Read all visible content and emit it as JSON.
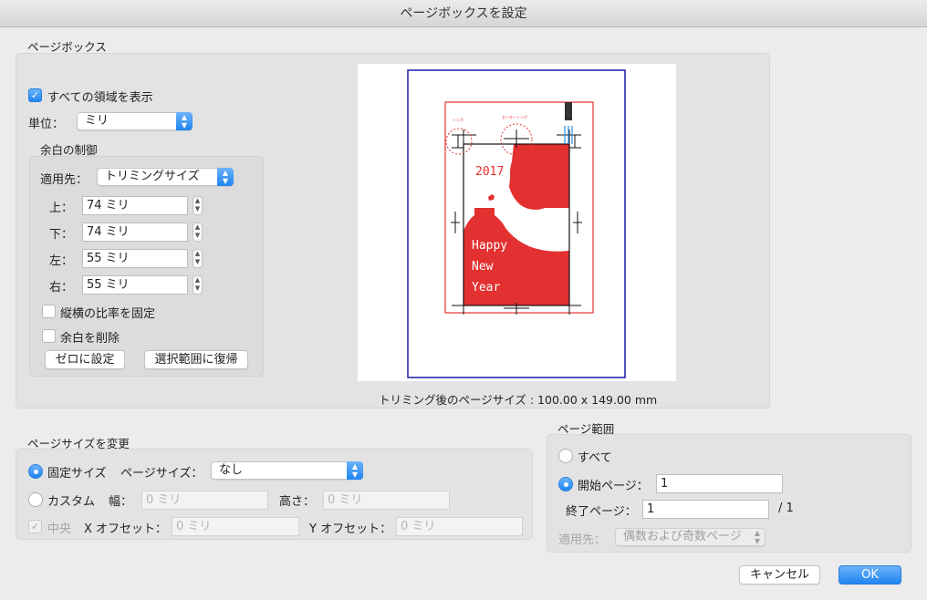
{
  "window": {
    "title": "ページボックスを設定"
  },
  "page_box": {
    "section_label": "ページボックス",
    "show_all": {
      "label": "すべての領域を表示",
      "checked": true
    },
    "unit": {
      "label": "単位：",
      "value": "ミリ"
    },
    "margins": {
      "section_label": "余白の制御",
      "apply_to": {
        "label": "適用先：",
        "value": "トリミングサイズ"
      },
      "top": {
        "label": "上：",
        "value": "74 ミリ"
      },
      "bottom": {
        "label": "下：",
        "value": "74 ミリ"
      },
      "left": {
        "label": "左：",
        "value": "55 ミリ"
      },
      "right": {
        "label": "右：",
        "value": "55 ミリ"
      },
      "constrain": {
        "label": "縦横の比率を固定",
        "checked": false
      },
      "remove_white": {
        "label": "余白を削除",
        "checked": false
      },
      "set_zero_label": "ゼロに設定",
      "revert_label": "選択範囲に復帰"
    },
    "preview": {
      "caption": "トリミング後のページサイズ : 100.00 x 149.00 mm",
      "card_text": {
        "year": "2017",
        "line1": "Happy",
        "line2": "New",
        "line3": "Year",
        "tag_left": "トンボ",
        "tag_center": "センタートンボ"
      },
      "colors": {
        "media": "#1a1aa8",
        "trim": "#e63232",
        "art": "#e33030"
      }
    }
  },
  "page_size": {
    "section_label": "ページサイズを変更",
    "fixed": {
      "label": "固定サイズ",
      "selected": true
    },
    "page_size_label": "ページサイズ：",
    "page_size_value": "なし",
    "custom": {
      "label": "カスタム",
      "selected": false
    },
    "width": {
      "label": "幅：",
      "placeholder": "0 ミリ"
    },
    "height": {
      "label": "高さ：",
      "placeholder": "0 ミリ"
    },
    "center": {
      "label": "中央",
      "checked": true
    },
    "x_offset": {
      "label": "X オフセット：",
      "placeholder": "0 ミリ"
    },
    "y_offset": {
      "label": "Y オフセット：",
      "placeholder": "0 ミリ"
    }
  },
  "page_range": {
    "section_label": "ページ範囲",
    "all": {
      "label": "すべて",
      "selected": false
    },
    "start": {
      "label": "開始ページ：",
      "value": "1",
      "selected": true
    },
    "end": {
      "label": "終了ページ：",
      "value": "1"
    },
    "total": "/ 1",
    "apply_to": {
      "label": "適用先：",
      "value": "偶数および奇数ページ"
    }
  },
  "footer": {
    "cancel_label": "キャンセル",
    "ok_label": "OK"
  }
}
